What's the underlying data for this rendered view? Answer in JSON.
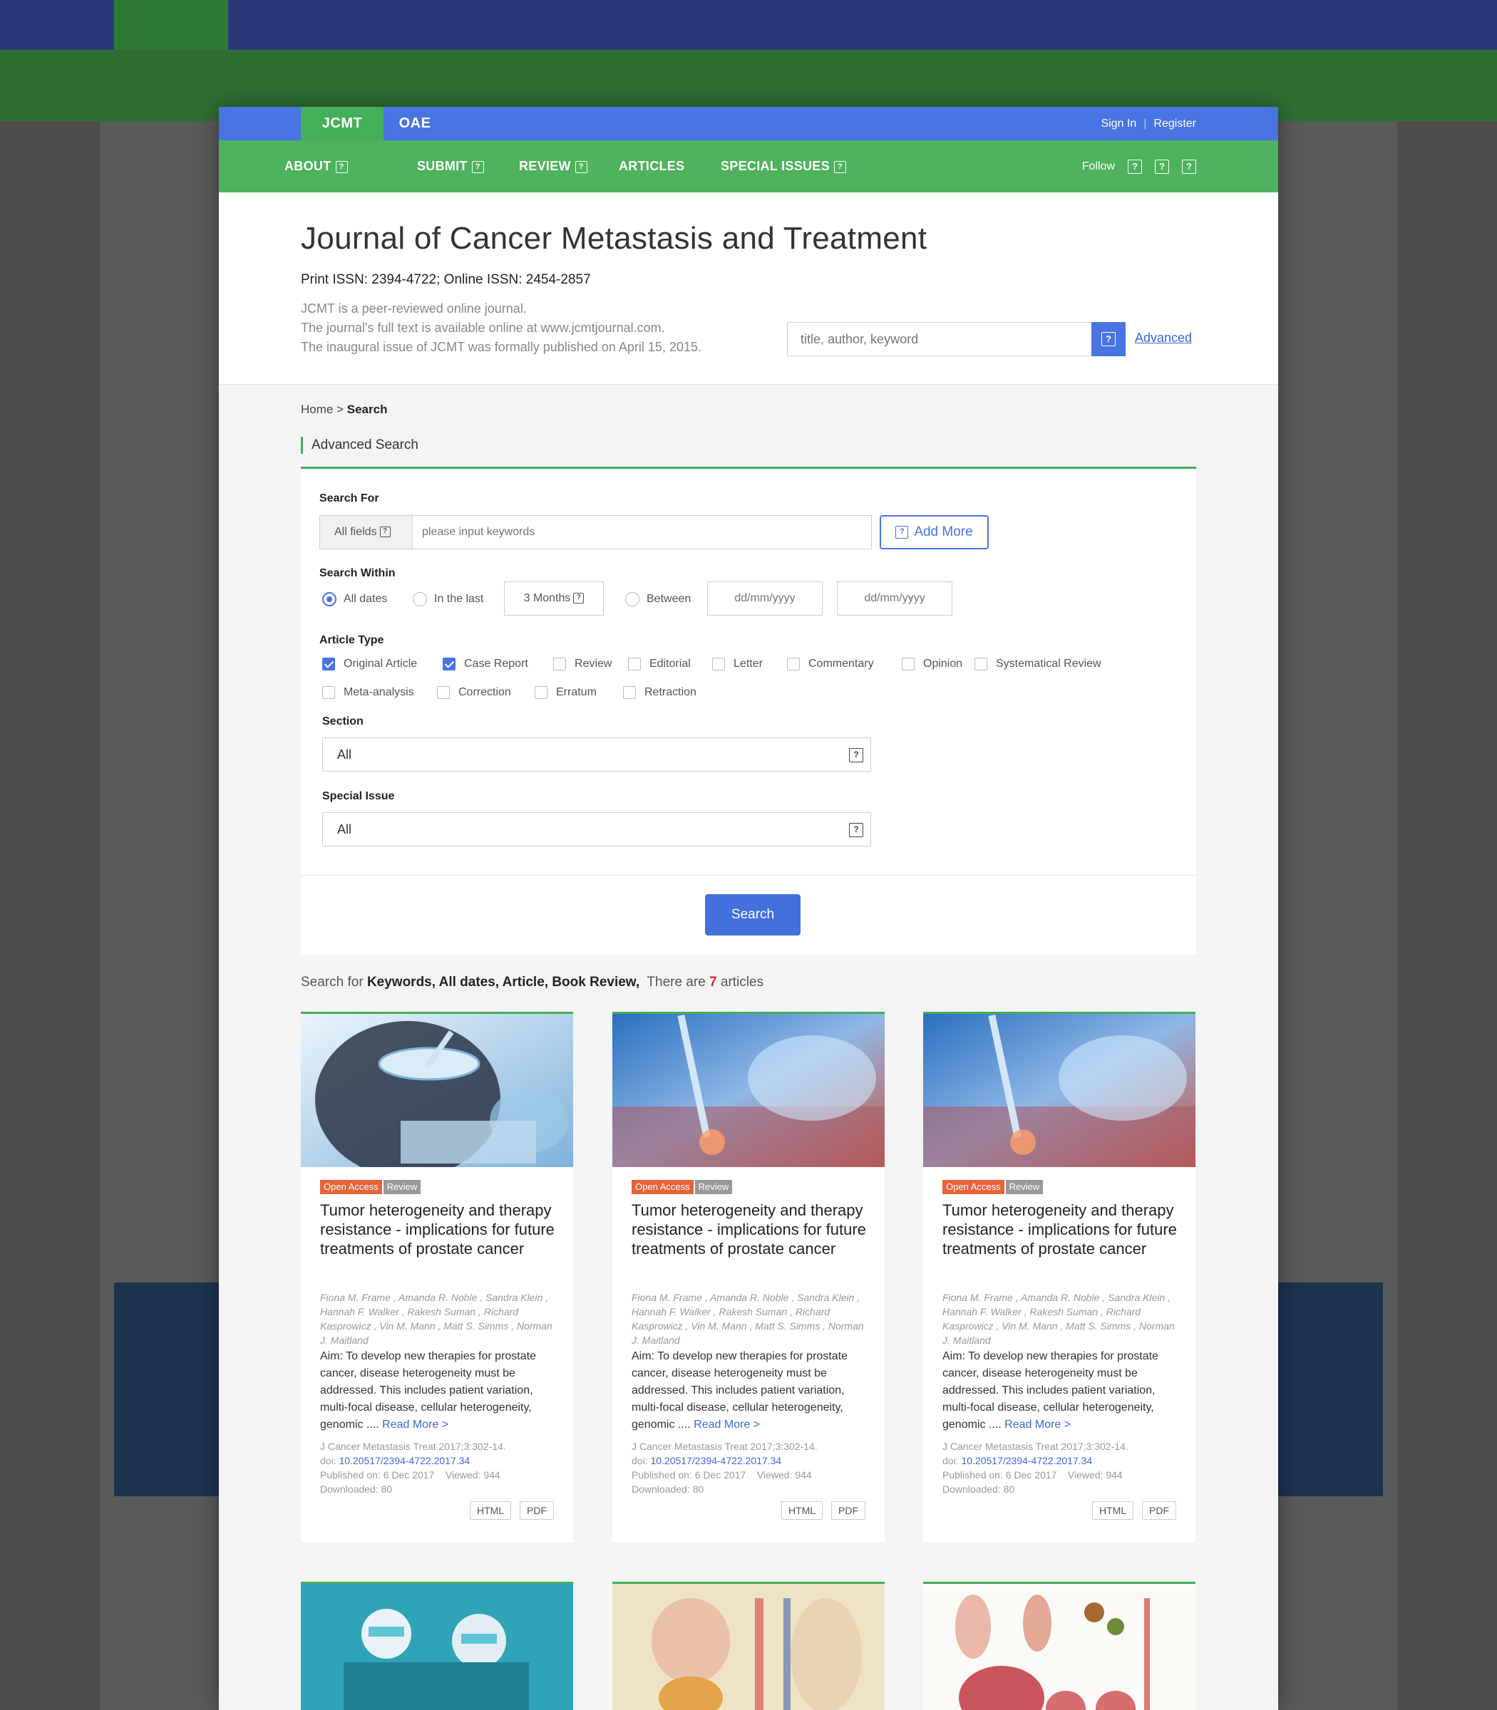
{
  "topbar": {
    "tabs": [
      "JCMT",
      "OAE"
    ],
    "sign_in": "Sign In",
    "separator": "|",
    "register": "Register"
  },
  "nav": {
    "items": [
      "ABOUT",
      "SUBMIT",
      "REVIEW",
      "ARTICLES",
      "SPECIAL ISSUES"
    ],
    "follow": "Follow"
  },
  "header": {
    "title": "Journal of Cancer Metastasis and Treatment",
    "issn": "Print ISSN: 2394-4722; Online ISSN: 2454-2857",
    "desc": [
      "JCMT is a peer-reviewed online journal.",
      "The journal's full text is available online at www.jcmtjournal.com.",
      "The inaugural issue of JCMT was formally published on April 15, 2015."
    ],
    "search_placeholder": "title, author, keyword",
    "advanced": "Advanced"
  },
  "breadcrumb": {
    "home": "Home",
    "sep": ">",
    "current": "Search"
  },
  "section_title": "Advanced Search",
  "form": {
    "search_for_label": "Search For",
    "field_select": "All fields",
    "keyword_placeholder": "please input keywords",
    "add_more": "Add More",
    "search_within_label": "Search Within",
    "within_options": [
      "All dates",
      "In the last",
      "Between"
    ],
    "within_selected": "All dates",
    "months": "3 Months",
    "date_placeholder": "dd/mm/yyyy",
    "date_sep": "-",
    "article_type_label": "Article Type",
    "article_types": [
      {
        "label": "Original Article",
        "checked": true
      },
      {
        "label": "Case Report",
        "checked": true
      },
      {
        "label": "Review",
        "checked": false
      },
      {
        "label": "Editorial",
        "checked": false
      },
      {
        "label": "Letter",
        "checked": false
      },
      {
        "label": "Commentary",
        "checked": false
      },
      {
        "label": "Opinion",
        "checked": false
      },
      {
        "label": "Systematical Review",
        "checked": false
      },
      {
        "label": "Meta-analysis",
        "checked": false
      },
      {
        "label": "Correction",
        "checked": false
      },
      {
        "label": "Erratum",
        "checked": false
      },
      {
        "label": "Retraction",
        "checked": false
      }
    ],
    "section_label": "Section",
    "section_value": "All",
    "special_issue_label": "Special Issue",
    "special_issue_value": "All",
    "search_button": "Search"
  },
  "results": {
    "prefix": "Search for",
    "query": "Keywords, All dates, Article, Book Review,",
    "there_are": "There are",
    "count": "7",
    "suffix": "articles"
  },
  "card": {
    "badge_oa": "Open Access",
    "badge_type": "Review",
    "title": "Tumor heterogeneity and therapy resistance - implications for future treatments of prostate cancer",
    "authors": "Fiona M. Frame , Amanda R. Noble , Sandra Klein , Hannah F. Walker , Rakesh Suman , Richard Kasprowicz , Vin M. Mann , Matt S. Simms , Norman J. Maitland",
    "abstract": "Aim: To develop new therapies for prostate cancer, disease heterogeneity must be addressed. This includes patient variation, multi-focal disease, cellular heterogeneity, genomic ....",
    "read_more": "Read More >",
    "citation": "J Cancer Metastasis Treat 2017;3:302-14.",
    "doi_label": "doi:",
    "doi": "10.20517/2394-4722.2017.34",
    "published": "Published on: 6 Dec 2017",
    "viewed": "Viewed: 944",
    "downloaded": "Downloaded: 80",
    "html_btn": "HTML",
    "pdf_btn": "PDF"
  },
  "colors": {
    "topbar_blue": "#4774e1",
    "nav_green": "#4eb35c",
    "accent_red": "#e0262c",
    "badge_orange": "#e8623a"
  }
}
